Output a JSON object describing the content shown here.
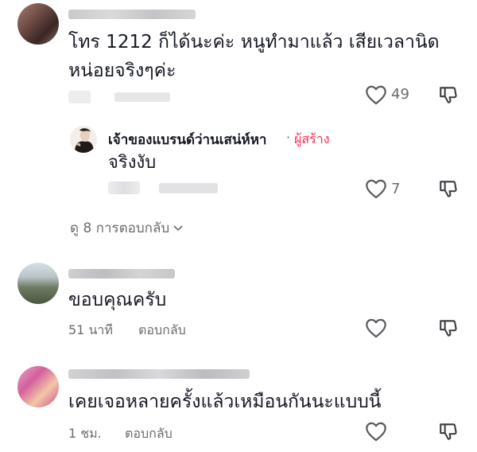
{
  "comments": [
    {
      "text_line1": "โทร 1212 ก็ได้นะค่ะ หนูทำมาแล้ว เสียเวลานิด",
      "text_line2": "หน่อยจริงๆค่ะ",
      "likes": "49"
    },
    {
      "text": "ขอบคุณครับ",
      "time": "51 นาที",
      "reply_label": "ตอบกลับ"
    },
    {
      "text": "เคยเจอหลายครั้งแล้วเหมือนกันนะแบบนี้",
      "time": "1 ชม.",
      "reply_label": "ตอบกลับ"
    }
  ],
  "creator_reply": {
    "name": "เจ้าของแบรนด์ว่านเสน่ห์หา",
    "separator": "·",
    "tag": "ผู้สร้าง",
    "text": "จริงงับ",
    "likes": "7"
  },
  "view_replies": {
    "label": "ดู 8 การตอบกลับ"
  },
  "icons": {
    "like": "heart-outline-icon",
    "dislike": "thumbs-down-icon",
    "chevron": "chevron-down-icon"
  },
  "colors": {
    "creator_tag": "#fe2c55",
    "muted": "#6b6b70"
  }
}
